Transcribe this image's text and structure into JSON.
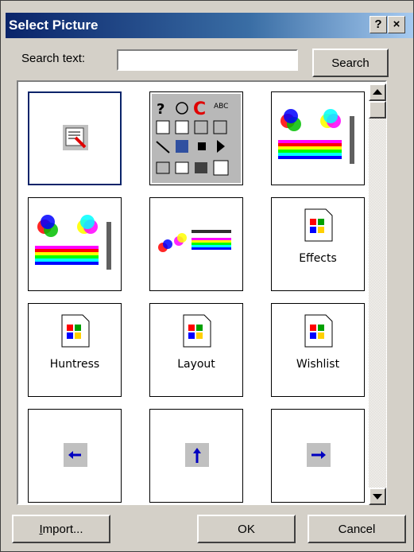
{
  "window": {
    "title": "Select Picture",
    "help_glyph": "?",
    "close_glyph": "×"
  },
  "search": {
    "label": "Search text:",
    "value": "",
    "placeholder": "",
    "button_label": "Search"
  },
  "gallery": {
    "items": [
      {
        "kind": "icon",
        "icon": "picture-edit-icon",
        "label": "",
        "selected": true
      },
      {
        "kind": "icon",
        "icon": "toolbar-buttons-icon",
        "label": "",
        "selected": false
      },
      {
        "kind": "icon",
        "icon": "color-palette-icon",
        "label": "",
        "selected": false
      },
      {
        "kind": "icon",
        "icon": "color-palette-icon",
        "label": "",
        "selected": false
      },
      {
        "kind": "icon",
        "icon": "color-gradient-icon",
        "label": "",
        "selected": false
      },
      {
        "kind": "file",
        "icon": "windows-file-icon",
        "label": "Effects",
        "selected": false
      },
      {
        "kind": "file",
        "icon": "windows-file-icon",
        "label": "Huntress",
        "selected": false
      },
      {
        "kind": "file",
        "icon": "windows-file-icon",
        "label": "Layout",
        "selected": false
      },
      {
        "kind": "file",
        "icon": "windows-file-icon",
        "label": "Wishlist",
        "selected": false
      },
      {
        "kind": "arrow",
        "icon": "arrow-left-icon",
        "label": "",
        "selected": false
      },
      {
        "kind": "arrow",
        "icon": "arrow-up-icon",
        "label": "",
        "selected": false
      },
      {
        "kind": "arrow",
        "icon": "arrow-right-icon",
        "label": "",
        "selected": false
      }
    ]
  },
  "footer": {
    "import_label": "Import...",
    "import_mnemonic": "I",
    "import_rest": "mport...",
    "ok_label": "OK",
    "cancel_label": "Cancel"
  },
  "colors": {
    "titlebar_start": "#0a246a",
    "titlebar_end": "#a6caf0",
    "face": "#d4d0c8",
    "selection": "#0a246a",
    "arrow_blue": "#0000c0"
  }
}
